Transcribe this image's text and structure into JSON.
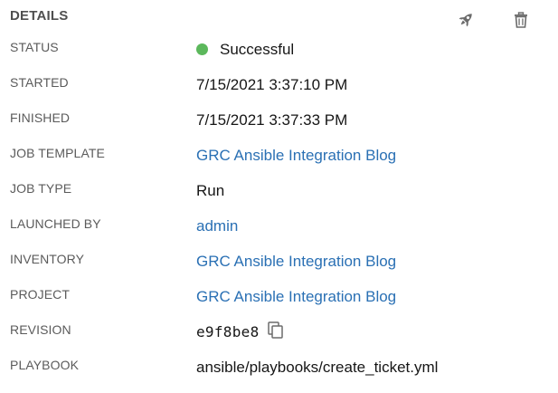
{
  "header": {
    "title": "DETAILS",
    "actions": [
      {
        "name": "launch",
        "icon": "rocket-icon"
      },
      {
        "name": "delete",
        "icon": "trash-icon"
      }
    ]
  },
  "colors": {
    "link": "#2a70b4",
    "status_success": "#5cb85c",
    "label": "#5b5b5b",
    "icon": "#6b6b6b"
  },
  "details": {
    "status": {
      "label": "STATUS",
      "value": "Successful"
    },
    "started": {
      "label": "STARTED",
      "value": "7/15/2021 3:37:10 PM"
    },
    "finished": {
      "label": "FINISHED",
      "value": "7/15/2021 3:37:33 PM"
    },
    "job_template": {
      "label": "JOB TEMPLATE",
      "value": "GRC Ansible Integration Blog"
    },
    "job_type": {
      "label": "JOB TYPE",
      "value": "Run"
    },
    "launched_by": {
      "label": "LAUNCHED BY",
      "value": "admin"
    },
    "inventory": {
      "label": "INVENTORY",
      "value": "GRC Ansible Integration Blog"
    },
    "project": {
      "label": "PROJECT",
      "value": "GRC Ansible Integration Blog"
    },
    "revision": {
      "label": "REVISION",
      "value": "e9f8be8",
      "icon": "copy-icon"
    },
    "playbook": {
      "label": "PLAYBOOK",
      "value": "ansible/playbooks/create_ticket.yml"
    }
  }
}
